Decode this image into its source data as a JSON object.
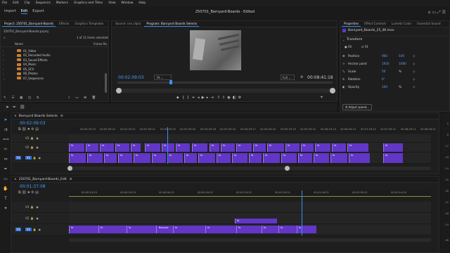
{
  "menu": [
    "File",
    "Edit",
    "Clip",
    "Sequence",
    "Markers",
    "Graphics and Titles",
    "View",
    "Window",
    "Help"
  ],
  "workspace_tabs": [
    "Import",
    "Edit",
    "Export"
  ],
  "doc_title": "250701_Barnyard-Boards - Edited",
  "project_panel": {
    "tabs": [
      "Project: 250701_Barnyard-Boards",
      "Effects",
      "Graphics Templates"
    ],
    "file": "250701_Barnyard-Boards.prproj",
    "count": "1 of 11 items selected",
    "col_name": "Name",
    "col_rate": "Frame Ra",
    "folders": [
      "01_Video",
      "02_Recorded Audio",
      "03_Sound Effects",
      "04_Music",
      "05_GFX",
      "06_Photos",
      "07_Sequences"
    ]
  },
  "program_panel": {
    "tabs": [
      "Source: (no clips)",
      "Program: Barnyard Boards Selects"
    ],
    "timecode": "00:02:09:03",
    "fit": "Fit",
    "full": "Full",
    "duration": "00:08:41:18"
  },
  "effect_controls": {
    "tabs": [
      "Properties",
      "Effect Controls",
      "Lumetri Color",
      "Essential Sound"
    ],
    "clip": "Barnyard_Boards_25_4K.mov",
    "section": "Transform",
    "fill": "Fill",
    "fit": "Fit",
    "props": [
      {
        "label": "Position",
        "v1": "960",
        "v2": "540"
      },
      {
        "label": "Anchor point",
        "v1": "1920",
        "v2": "1080"
      },
      {
        "label": "Scale",
        "v1": "50",
        "v2": "%"
      },
      {
        "label": "Rotation",
        "v1": "0°",
        "v2": ""
      },
      {
        "label": "Opacity",
        "v1": "100",
        "v2": "%"
      }
    ],
    "speed": "Adjust speed..."
  },
  "timeline1": {
    "name": "Barnyard Boards Selects",
    "timecode": "00:02:09:03",
    "ruler": [
      "00:00:29:23",
      "00:00:59:23",
      "00:01:29:21",
      "00:01:59:21",
      "00:02:29:20",
      "00:02:59:18",
      "00:03:29:18",
      "00:03:59:16",
      "00:04:29:17",
      "00:04:59:16",
      "00:05:29:15",
      "00:05:59:15",
      "00:06:29:14",
      "00:06:59:13",
      "00:07:29:12",
      "00:07:59:12",
      "00:08:29:11",
      "00:08:59:11"
    ],
    "tracks": [
      "V3",
      "V2",
      "V1"
    ]
  },
  "timeline2": {
    "name": "250701_Barnyard-Boards_Edit",
    "timecode": "00:01:37:08",
    "ruler": [
      "00:00:14:23",
      "00:00:29:23",
      "00:00:44:22",
      "00:00:59:22",
      "00:01:14:22",
      "00:01:29:21",
      "00:01:44:21",
      "00:01:59:21",
      "00:02:14:20"
    ],
    "tracks": [
      "V3",
      "V2",
      "V1"
    ],
    "clip_label": "Barnyar"
  },
  "meter_scale": [
    "0",
    "-6",
    "-12",
    "-18",
    "-24",
    "-30",
    "-36",
    "-42",
    "-48",
    "-54",
    "dB"
  ]
}
